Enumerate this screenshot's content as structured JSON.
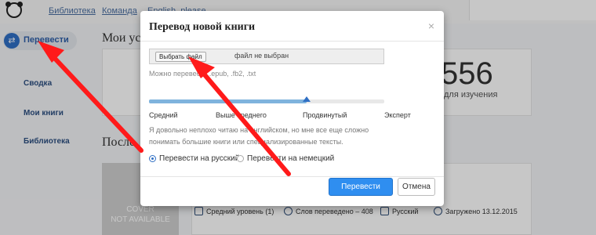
{
  "topnav": [
    "Библиотека",
    "Команда",
    "English, please"
  ],
  "sidebar": {
    "translate_label": "Перевести",
    "translate_icon": "swap-arrows-icon",
    "items": [
      "Сводка",
      "Мои книги",
      "Библиотека"
    ]
  },
  "main": {
    "section_title": "Мои усп",
    "stat_number": "556",
    "stat_label": "для изучения",
    "recent_title": "После",
    "cover_lines": [
      "COVER",
      "NOT AVAILABLE"
    ],
    "meta": [
      {
        "icon": "graduation-cap-icon",
        "text": "Средний уровень (1)"
      },
      {
        "icon": "search-icon",
        "text": "Слов переведено – 408"
      },
      {
        "icon": "language-icon",
        "text": "Русский"
      },
      {
        "icon": "clock-icon",
        "text": "Загружено 13.12.2015"
      }
    ]
  },
  "modal": {
    "title": "Перевод новой книги",
    "close": "×",
    "file_button": "Выбрать файл",
    "file_status": "файл не выбран",
    "help": "Можно перевести .epub, .fb2, .txt",
    "levels": [
      "Средний",
      "Выше среднего",
      "Продвинутый",
      "Эксперт"
    ],
    "level_fraction": 0.67,
    "level_description": "Я довольно неплохо читаю на английском, но мне все еще сложно понимать большие книги или специализированные тексты.",
    "radios": [
      {
        "label": "Перевести на русский",
        "selected": true
      },
      {
        "label": "Перевести на немецкий",
        "selected": false
      }
    ],
    "primary_button": "Перевести",
    "cancel_button": "Отмена"
  },
  "colors": {
    "accent": "#2f8ef0",
    "arrow": "#ff1a1a",
    "slider_fill": "#7fb3dd"
  }
}
